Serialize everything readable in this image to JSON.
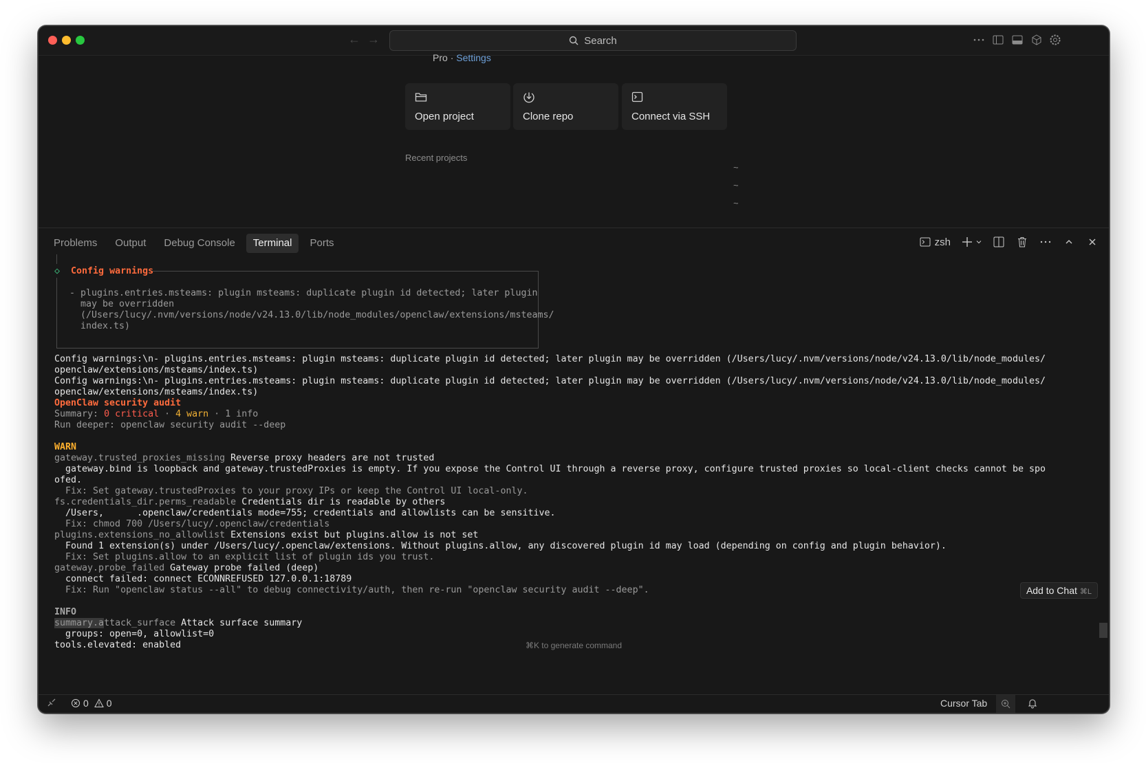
{
  "titlebar": {
    "search_placeholder": "Search"
  },
  "welcome": {
    "breadcrumb_left": "Pro",
    "breadcrumb_sep": "·",
    "breadcrumb_link": "Settings",
    "cards": [
      {
        "label": "Open project",
        "icon": "folder-icon"
      },
      {
        "label": "Clone repo",
        "icon": "clone-icon"
      },
      {
        "label": "Connect via SSH",
        "icon": "terminal-icon"
      }
    ],
    "recent_title": "Recent projects",
    "recent_markers": [
      "~",
      "~",
      "~"
    ]
  },
  "panel": {
    "tabs": [
      "Problems",
      "Output",
      "Debug Console",
      "Terminal",
      "Ports"
    ],
    "active_tab": "Terminal",
    "shell_name": "zsh"
  },
  "terminal": {
    "config_title": "Config warnings",
    "config_box_lines": [
      "- plugins.entries.msteams: plugin msteams: duplicate plugin id detected; later plugin",
      "  may be overridden",
      "  (/Users/lucy/.nvm/versions/node/v24.13.0/lib/node_modules/openclaw/extensions/msteams/",
      "  index.ts)"
    ],
    "config_raw_1a": "Config warnings:\\n- plugins.entries.msteams: plugin msteams: duplicate plugin id detected; later plugin may be overridden (/Users/lucy/.nvm/versions/node/v24.13.0/lib/node_modules/",
    "config_raw_1b": "openclaw/extensions/msteams/index.ts)",
    "config_raw_2a": "Config warnings:\\n- plugins.entries.msteams: plugin msteams: duplicate plugin id detected; later plugin may be overridden (/Users/lucy/.nvm/versions/node/v24.13.0/lib/node_modules/",
    "config_raw_2b": "openclaw/extensions/msteams/index.ts)",
    "audit_title": "OpenClaw security audit",
    "summary_label": "Summary: ",
    "summary_critical": "0 critical",
    "summary_sep1": " · ",
    "summary_warn": "4 warn",
    "summary_sep2": " · ",
    "summary_info": "1 info",
    "run_deeper": "Run deeper: openclaw security audit --deep",
    "warn_heading": "WARN",
    "w1_key": "gateway.trusted_proxies_missing",
    "w1_msg": " Reverse proxy headers are not trusted",
    "w1_detail_a": "  gateway.bind is loopback and gateway.trustedProxies is empty. If you expose the Control UI through a reverse proxy, configure trusted proxies so local-client checks cannot be spo",
    "w1_detail_b": "ofed.",
    "w1_fix": "  Fix: Set gateway.trustedProxies to your proxy IPs or keep the Control UI local-only.",
    "w2_key": "fs.credentials_dir.perms_readable",
    "w2_msg": " Credentials dir is readable by others",
    "w2_detail": "  /Users,      .openclaw/credentials mode=755; credentials and allowlists can be sensitive.",
    "w2_fix": "  Fix: chmod 700 /Users/lucy/.openclaw/credentials",
    "w3_key": "plugins.extensions_no_allowlist",
    "w3_msg": " Extensions exist but plugins.allow is not set",
    "w3_detail": "  Found 1 extension(s) under /Users/lucy/.openclaw/extensions. Without plugins.allow, any discovered plugin id may load (depending on config and plugin behavior).",
    "w3_fix": "  Fix: Set plugins.allow to an explicit list of plugin ids you trust.",
    "w4_key": "gateway.probe_failed",
    "w4_msg": " Gateway probe failed (deep)",
    "w4_detail": "  connect failed: connect ECONNREFUSED 127.0.0.1:18789",
    "w4_fix": "  Fix: Run \"openclaw status --all\" to debug connectivity/auth, then re-run \"openclaw security audit --deep\".",
    "info_heading": "INFO",
    "i1_key_a": "summary.a",
    "i1_key_b": "ttack_surface",
    "i1_msg": " Attack surface summary",
    "i1_detail": "  groups: open=0, allowlist=0",
    "i1_detail2": "tools.elevated: enabled",
    "add_to_chat": "Add to Chat",
    "add_to_chat_kbd": "⌘L",
    "generate_hint": "⌘K to generate command"
  },
  "statusbar": {
    "errors": "0",
    "warnings": "0",
    "cursor_tab": "Cursor Tab"
  },
  "colors": {
    "accent_link": "#6ea0d8",
    "error_red": "#ff5c4d",
    "warn_yellow": "#ffb02e"
  }
}
